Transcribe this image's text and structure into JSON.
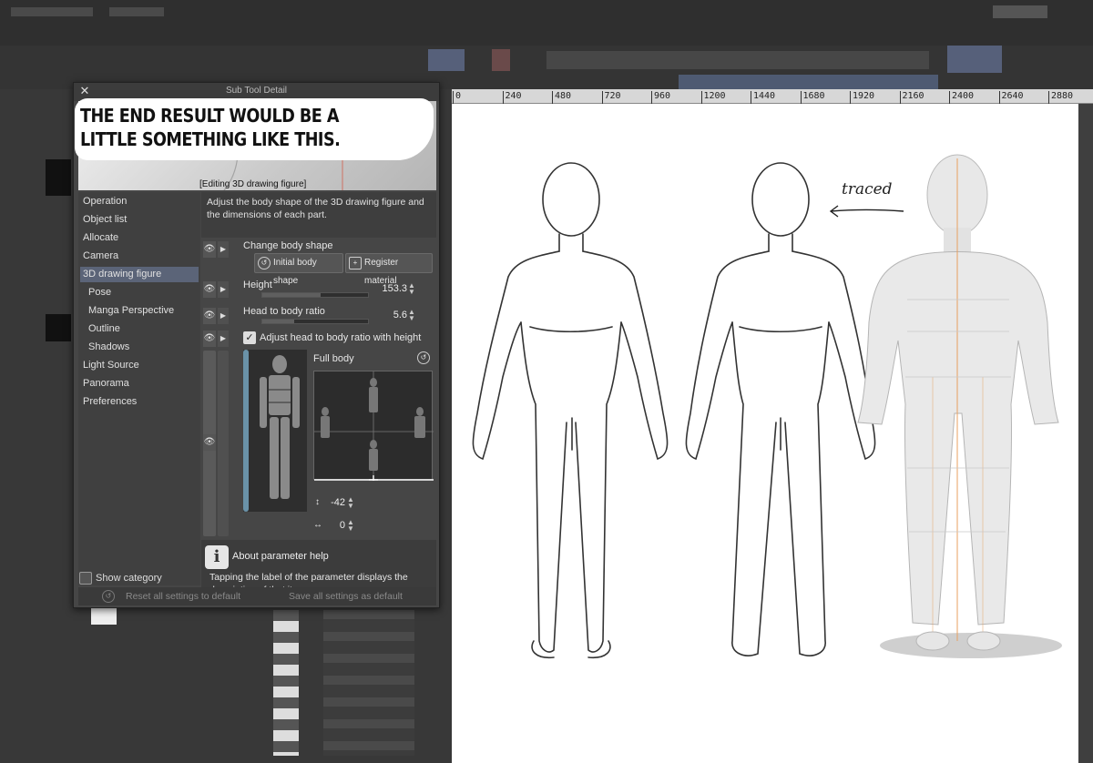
{
  "dialog": {
    "title": "Sub Tool Detail",
    "close_glyph": "✕",
    "preview_caption": "[Editing 3D drawing figure]",
    "description": "Adjust the body shape of the 3D drawing figure and the dimensions of each part.",
    "categories": [
      {
        "label": "Operation"
      },
      {
        "label": "Object list"
      },
      {
        "label": "Allocate"
      },
      {
        "label": "Camera"
      },
      {
        "label": "3D drawing figure",
        "selected": true
      },
      {
        "label": "Pose",
        "sub": true
      },
      {
        "label": "Manga Perspective",
        "sub": true
      },
      {
        "label": "Outline",
        "sub": true
      },
      {
        "label": "Shadows",
        "sub": true
      },
      {
        "label": "Light Source"
      },
      {
        "label": "Panorama"
      },
      {
        "label": "Preferences"
      }
    ],
    "show_category_label": "Show category",
    "change_body_shape_label": "Change body shape",
    "initial_body_shape_button": "Initial body shape",
    "register_material_button": "Register material",
    "height": {
      "label": "Height",
      "value": "153.3"
    },
    "head_ratio": {
      "label": "Head to body ratio",
      "value": "5.6"
    },
    "adjust_checkbox_label": "Adjust head to body ratio with height",
    "adjust_checked": true,
    "full_body_label": "Full body",
    "vertical_offset": "-42",
    "horizontal_offset": "0",
    "help_title": "About parameter help",
    "help_body": "Tapping the label of the parameter displays the description of that item.",
    "reset_button": "Reset all settings to default",
    "save_button": "Save all settings as default"
  },
  "caption": {
    "text": "THE END RESULT WOULD BE A LITTLE SOMETHING LIKE THIS."
  },
  "ruler": {
    "ticks": [
      "0",
      "240",
      "480",
      "720",
      "960",
      "1200",
      "1440",
      "1680",
      "1920",
      "2160",
      "2400",
      "2640",
      "2880"
    ]
  },
  "canvas": {
    "annotation": "traced"
  },
  "colors": {
    "selection": "#5b6478",
    "accent_bar": "#6a92a8",
    "canvas_bg": "#ffffff"
  }
}
